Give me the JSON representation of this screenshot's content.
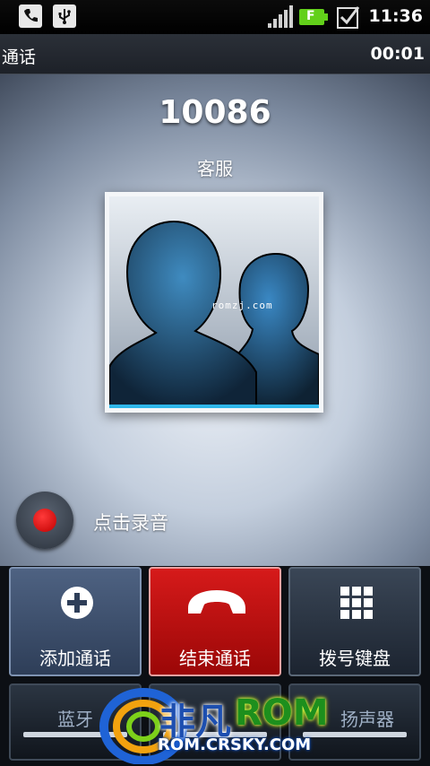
{
  "status_bar": {
    "time": "11:36",
    "battery_label": "F",
    "icons": [
      "phone-icon",
      "usb-icon",
      "signal-icon",
      "battery-icon",
      "checkbox-icon"
    ]
  },
  "title_bar": {
    "title": "通话",
    "timer": "00:01"
  },
  "caller": {
    "number": "10086",
    "label": "客服",
    "photo_watermark": "romzj.com"
  },
  "record": {
    "label": "点击录音"
  },
  "buttons": [
    {
      "label": "添加通话",
      "icon": "plus-circle-icon"
    },
    {
      "label": "结束通话",
      "icon": "hangup-phone-icon"
    },
    {
      "label": "拨号键盘",
      "icon": "dialpad-icon"
    }
  ],
  "second_row": [
    {
      "label": "蓝牙"
    },
    {
      "label": ""
    },
    {
      "label": "扬声器"
    }
  ],
  "overlay_logo": {
    "brand_cn": "非凡",
    "brand_en": "ROM",
    "url": "ROM.CRSKY.COM"
  },
  "colors": {
    "end_call_red": "#c40b0b",
    "button_blue": "#3b4d6b",
    "record_red": "#e00000"
  }
}
